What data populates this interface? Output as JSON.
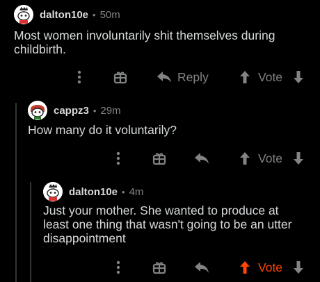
{
  "colors": {
    "background": "#000000",
    "text_primary": "#d7dadc",
    "text_muted": "#818384",
    "thread_line": "#343536",
    "upvote_active": "#ff4500"
  },
  "comments": [
    {
      "username": "dalton10e",
      "separator": "•",
      "age": "50m",
      "body": "Most women involuntarily shit themselves during childbirth.",
      "actions": {
        "more_icon": "more-vertical-icon",
        "award_icon": "gift-icon",
        "reply_icon": "reply-arrow-icon",
        "reply_label": "Reply",
        "upvote_icon": "upvote-arrow-icon",
        "vote_label": "Vote",
        "downvote_icon": "downvote-arrow-icon",
        "upvoted": false
      }
    },
    {
      "username": "cappz3",
      "separator": "•",
      "age": "29m",
      "body": "How many do it voluntarily?",
      "actions": {
        "more_icon": "more-vertical-icon",
        "award_icon": "gift-icon",
        "reply_icon": "reply-arrow-icon",
        "upvote_icon": "upvote-arrow-icon",
        "vote_label": "Vote",
        "downvote_icon": "downvote-arrow-icon",
        "upvoted": false
      }
    },
    {
      "username": "dalton10e",
      "separator": "•",
      "age": "4m",
      "body": "Just your mother. She wanted to produce at least one thing that wasn't going to be an utter disappointment",
      "actions": {
        "more_icon": "more-vertical-icon",
        "award_icon": "gift-icon",
        "reply_icon": "reply-arrow-icon",
        "upvote_icon": "upvote-arrow-icon",
        "vote_label": "Vote",
        "downvote_icon": "downvote-arrow-icon",
        "upvoted": true
      }
    }
  ]
}
